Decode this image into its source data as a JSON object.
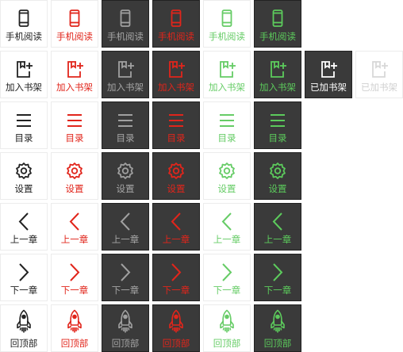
{
  "colors": {
    "black": "#222222",
    "red": "#e1251b",
    "gray": "#a0a0a0",
    "light_green": "#66cc66",
    "dark_green": "#5ccb5c",
    "dark_tile_bg": "#3a3a3a",
    "faded": "#d0d0d0"
  },
  "variants": [
    "black-on-white",
    "red-on-white",
    "gray-on-dark",
    "red-on-dark",
    "green-on-white",
    "green-on-dark"
  ],
  "rows": [
    {
      "icon": "phone-icon",
      "label": "手机阅读"
    },
    {
      "icon": "add-bookshelf-icon",
      "label": "加入书架",
      "extra": [
        {
          "icon": "added-bookshelf-icon",
          "label": "已加书架",
          "state": "added (dark)"
        },
        {
          "icon": "added-bookshelf-icon",
          "label": "已加书架",
          "state": "added (disabled)"
        }
      ]
    },
    {
      "icon": "menu-list-icon",
      "label": "目录"
    },
    {
      "icon": "gear-icon",
      "label": "设置"
    },
    {
      "icon": "chevron-left-icon",
      "label": "上一章"
    },
    {
      "icon": "chevron-right-icon",
      "label": "下一章"
    },
    {
      "icon": "rocket-icon",
      "label": "回顶部"
    }
  ]
}
